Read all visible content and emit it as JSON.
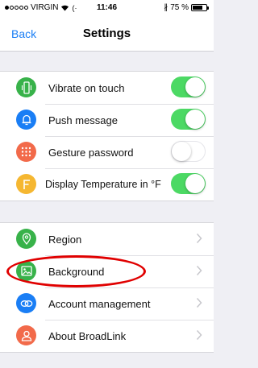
{
  "status_bar": {
    "carrier": "VIRGIN",
    "time": "11:46",
    "battery": "75 %",
    "battery_level": 0.75
  },
  "nav": {
    "back_label": "Back",
    "title": "Settings"
  },
  "toggles": [
    {
      "label": "Vibrate on touch",
      "icon": "phone-vibrate-icon",
      "color": "#38b24a",
      "on": true
    },
    {
      "label": "Push message",
      "icon": "bell-icon",
      "color": "#1a7ef5",
      "on": true
    },
    {
      "label": "Gesture password",
      "icon": "keypad-grid-icon",
      "color": "#f26a4a",
      "on": false
    },
    {
      "label": "Display Temperature in °F",
      "icon": "fahrenheit-icon",
      "color": "#f5b731",
      "on": true
    }
  ],
  "nav_items": [
    {
      "label": "Region",
      "icon": "location-pin-icon",
      "color": "#38b24a"
    },
    {
      "label": "Background",
      "icon": "image-icon",
      "color": "#38b24a"
    },
    {
      "label": "Account management",
      "icon": "link-icon",
      "color": "#1a7ef5"
    },
    {
      "label": "About BroadLink",
      "icon": "person-icon",
      "color": "#f26a4a"
    }
  ],
  "colors": {
    "accent": "#1a7ef5",
    "toggle_on": "#4cd964",
    "highlight": "#e00000"
  }
}
